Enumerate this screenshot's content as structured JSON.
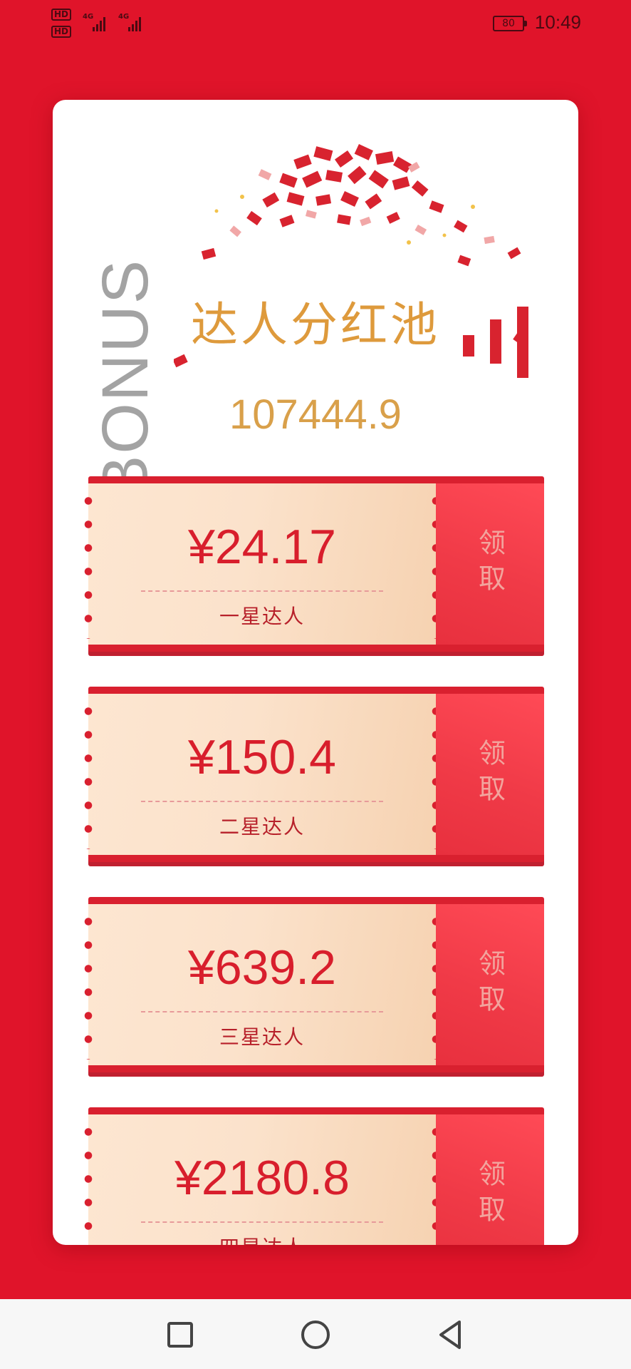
{
  "status_bar": {
    "hd_label_1": "HD",
    "hd_label_2": "HD",
    "network_1": "4G",
    "network_2": "4G",
    "battery": "80",
    "time": "10:49"
  },
  "header": {
    "bonus_word": "BONUS",
    "title": "达人分红池",
    "pool_amount": "107444.9"
  },
  "coupons": [
    {
      "amount": "¥24.17",
      "level": "一星达人",
      "claim_label": "领取"
    },
    {
      "amount": "¥150.4",
      "level": "二星达人",
      "claim_label": "领取"
    },
    {
      "amount": "¥639.2",
      "level": "三星达人",
      "claim_label": "领取"
    },
    {
      "amount": "¥2180.8",
      "level": "四星达人",
      "claim_label": "领取"
    }
  ],
  "colors": {
    "background": "#e0142a",
    "title_gold": "#de9a3c",
    "coupon_red": "#d81e2c",
    "bonus_gray": "#a3a3a3"
  },
  "nav": {
    "icons": [
      "square-recent-apps-icon",
      "circle-home-icon",
      "triangle-back-icon"
    ]
  }
}
